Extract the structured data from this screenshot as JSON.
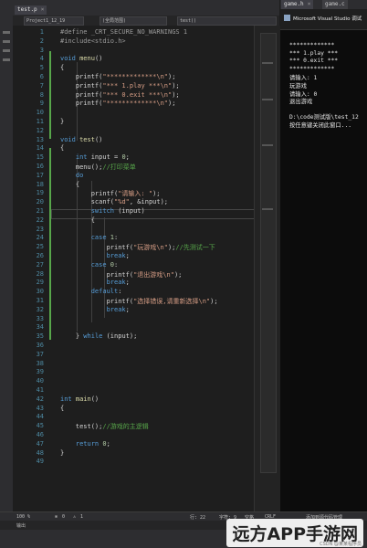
{
  "tabs": {
    "primary": [
      {
        "label": "test.p",
        "close": "×"
      },
      {
        "label": "Project1_12_19",
        "close": ""
      },
      {
        "label": "(全局范围)",
        "close": ""
      },
      {
        "label": "test()",
        "close": ""
      }
    ],
    "right": [
      {
        "label": "game.h",
        "close": "×"
      },
      {
        "label": "game.c",
        "close": ""
      }
    ]
  },
  "editor": {
    "line_numbers": [
      "1",
      "2",
      "3",
      "4",
      "5",
      "6",
      "7",
      "8",
      "9",
      "10",
      "11",
      "12",
      "13",
      "14",
      "15",
      "16",
      "17",
      "18",
      "19",
      "20",
      "21",
      "22",
      "23",
      "24",
      "25",
      "26",
      "27",
      "28",
      "29",
      "30",
      "31",
      "32",
      "33",
      "34",
      "35",
      "36",
      "37",
      "38",
      "39",
      "40",
      "41",
      "42",
      "43",
      "44",
      "45",
      "46",
      "47",
      "48",
      "49"
    ],
    "code": [
      {
        "n": 1,
        "parts": [
          [
            "pp",
            "#define _CRT_SECURE_NO_WARNINGS 1"
          ]
        ]
      },
      {
        "n": 2,
        "parts": [
          [
            "pp",
            "#include<stdio.h>"
          ]
        ]
      },
      {
        "n": 4,
        "parts": [
          [
            "kw",
            "void "
          ],
          [
            "fn",
            "menu"
          ],
          [
            "",
            "()"
          ]
        ]
      },
      {
        "n": 5,
        "parts": [
          [
            "",
            "{"
          ]
        ]
      },
      {
        "n": 6,
        "parts": [
          [
            "",
            "    printf("
          ],
          [
            "str",
            "\"*************\\n\""
          ],
          [
            "",
            ");"
          ]
        ]
      },
      {
        "n": 7,
        "parts": [
          [
            "",
            "    printf("
          ],
          [
            "str",
            "\"*** 1.play ***\\n\""
          ],
          [
            "",
            ");"
          ]
        ]
      },
      {
        "n": 8,
        "parts": [
          [
            "",
            "    printf("
          ],
          [
            "str",
            "\"*** 0.exit ***\\n\""
          ],
          [
            "",
            ");"
          ]
        ]
      },
      {
        "n": 9,
        "parts": [
          [
            "",
            "    printf("
          ],
          [
            "str",
            "\"*************\\n\""
          ],
          [
            "",
            ");"
          ]
        ]
      },
      {
        "n": 11,
        "parts": [
          [
            "",
            "}"
          ]
        ]
      },
      {
        "n": 13,
        "parts": [
          [
            "kw",
            "void "
          ],
          [
            "fn",
            "test"
          ],
          [
            "",
            "()"
          ]
        ]
      },
      {
        "n": 14,
        "parts": [
          [
            "",
            "{"
          ]
        ]
      },
      {
        "n": 15,
        "parts": [
          [
            "kw",
            "    int "
          ],
          [
            "",
            "input = "
          ],
          [
            "num",
            "0"
          ],
          [
            "",
            ";"
          ]
        ]
      },
      {
        "n": 16,
        "parts": [
          [
            "",
            "    menu();"
          ],
          [
            "cm",
            "//打印菜单"
          ]
        ]
      },
      {
        "n": 17,
        "parts": [
          [
            "kw",
            "    do"
          ]
        ]
      },
      {
        "n": 18,
        "parts": [
          [
            "",
            "    {"
          ]
        ]
      },
      {
        "n": 19,
        "parts": [
          [
            "",
            "        printf("
          ],
          [
            "str",
            "\"请输入: \""
          ],
          [
            "",
            ");"
          ]
        ]
      },
      {
        "n": 20,
        "parts": [
          [
            "",
            "        scanf("
          ],
          [
            "str",
            "\"%d\""
          ],
          [
            "",
            ", &input);"
          ]
        ]
      },
      {
        "n": 21,
        "parts": [
          [
            "kw",
            "        switch "
          ],
          [
            "",
            "(input)"
          ]
        ]
      },
      {
        "n": 22,
        "parts": [
          [
            "",
            "        {"
          ]
        ]
      },
      {
        "n": 24,
        "parts": [
          [
            "kw",
            "        case "
          ],
          [
            "num",
            "1"
          ],
          [
            "",
            ":"
          ]
        ]
      },
      {
        "n": 25,
        "parts": [
          [
            "",
            "            printf("
          ],
          [
            "str",
            "\"玩游戏\\n\""
          ],
          [
            "",
            ");"
          ],
          [
            "cm",
            "//先测试一下"
          ]
        ]
      },
      {
        "n": 26,
        "parts": [
          [
            "kw",
            "            break"
          ],
          [
            "",
            ";"
          ]
        ]
      },
      {
        "n": 27,
        "parts": [
          [
            "kw",
            "        case "
          ],
          [
            "num",
            "0"
          ],
          [
            "",
            ":"
          ]
        ]
      },
      {
        "n": 28,
        "parts": [
          [
            "",
            "            printf("
          ],
          [
            "str",
            "\"退出游戏\\n\""
          ],
          [
            "",
            ");"
          ]
        ]
      },
      {
        "n": 29,
        "parts": [
          [
            "kw",
            "            break"
          ],
          [
            "",
            ";"
          ]
        ]
      },
      {
        "n": 30,
        "parts": [
          [
            "kw",
            "        default"
          ],
          [
            "",
            ":"
          ]
        ]
      },
      {
        "n": 31,
        "parts": [
          [
            "",
            "            printf("
          ],
          [
            "str",
            "\"选择错误,请重新选择\\n\""
          ],
          [
            "",
            ");"
          ]
        ]
      },
      {
        "n": 32,
        "parts": [
          [
            "kw",
            "            break"
          ],
          [
            "",
            ";"
          ]
        ]
      },
      {
        "n": 35,
        "parts": [
          [
            "",
            "    } "
          ],
          [
            "kw",
            "while "
          ],
          [
            "",
            "(input);"
          ]
        ]
      },
      {
        "n": 42,
        "parts": [
          [
            "kw",
            "int "
          ],
          [
            "fn",
            "main"
          ],
          [
            "",
            "()"
          ]
        ]
      },
      {
        "n": 43,
        "parts": [
          [
            "",
            "{"
          ]
        ]
      },
      {
        "n": 45,
        "parts": [
          [
            "",
            "    test();"
          ],
          [
            "cm",
            "//游戏的主逻辑"
          ]
        ]
      },
      {
        "n": 47,
        "parts": [
          [
            "kw",
            "    return "
          ],
          [
            "num",
            "0"
          ],
          [
            "",
            ";"
          ]
        ]
      },
      {
        "n": 48,
        "parts": [
          [
            "",
            "}"
          ]
        ]
      }
    ]
  },
  "console": {
    "title": "Microsoft Visual Studio 调试",
    "lines": [
      "*************",
      "*** 1.play ***",
      "*** 0.exit ***",
      "*************",
      "请输入: 1",
      "玩游戏",
      "请输入: 0",
      "退出游戏",
      "",
      "D:\\code测试版\\test_12",
      "按任意键关闭此窗口..."
    ]
  },
  "statusbar": {
    "zoom": "100 %",
    "issues": "0",
    "warnings": "1",
    "line": "行: 22",
    "char": "字符: 9",
    "col": "空格",
    "encoding": "CRLF",
    "git": "添加到源代码管理"
  },
  "output": {
    "label": "输出"
  },
  "watermark": {
    "text": "远方APP手游网",
    "sub": "CSDN @某某程序员"
  }
}
